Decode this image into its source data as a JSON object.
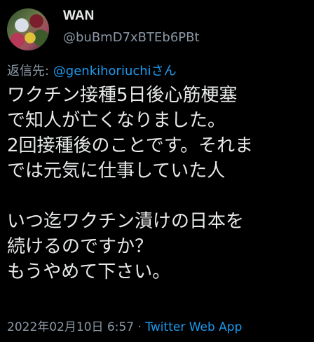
{
  "user": {
    "display_name": "WAN",
    "handle": "@buBmD7xBTEb6PBt"
  },
  "reply": {
    "prefix": "返信先: ",
    "target": "@genkihoriuchiさん"
  },
  "tweet": {
    "text": "ワクチン接種5日後心筋梗塞\nで知人が亡くなりました。\n2回接種後のことです。それま\nでは元気に仕事していた人\n\nいつ迄ワクチン漬けの日本を\n続けるのですか？\nもうやめて下さい。"
  },
  "meta": {
    "timestamp": "2022年02月10日 6:57",
    "separator": " · ",
    "source": "Twitter Web App"
  },
  "colors": {
    "background": "#000000",
    "text": "#e7e9ea",
    "secondary": "#8b98a5",
    "link": "#1d9bf0"
  }
}
